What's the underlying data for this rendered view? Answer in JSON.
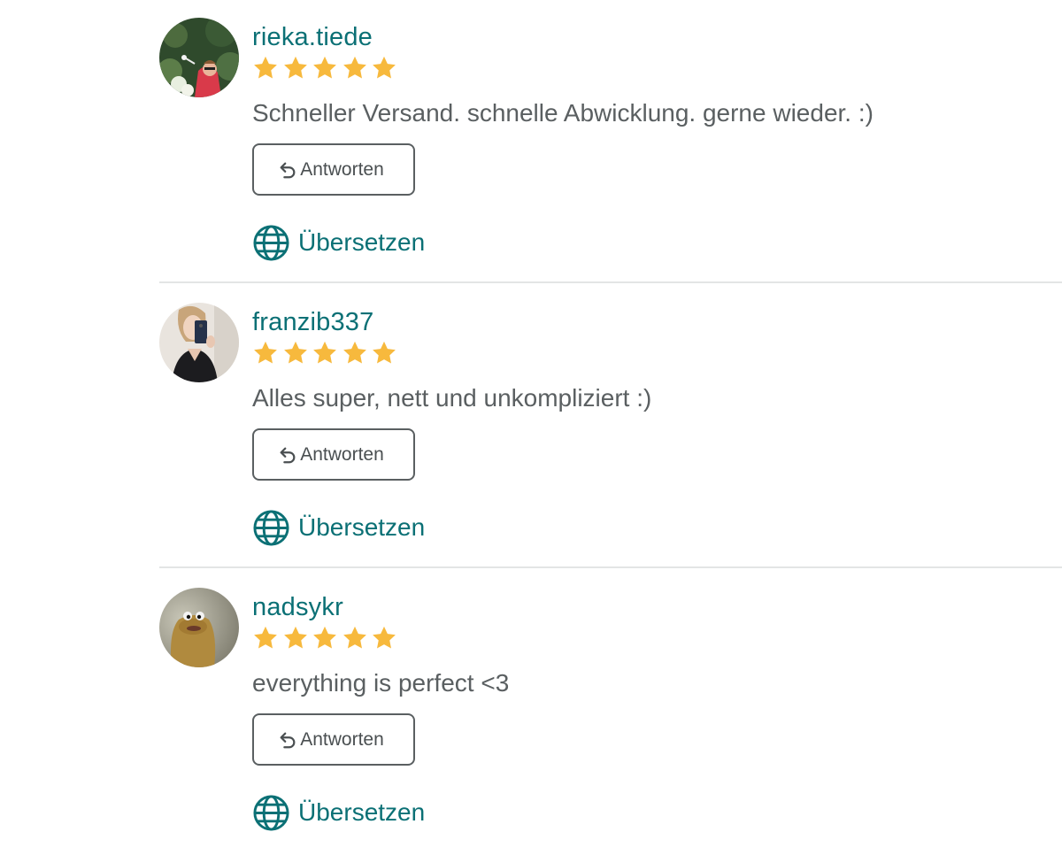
{
  "colors": {
    "accent": "#0b7075",
    "text": "#5a5f61",
    "star": "#f7b93d",
    "divider": "#e3e5e5"
  },
  "reviews": [
    {
      "username": "rieka.tiede",
      "rating": 5,
      "comment": "Schneller Versand. schnelle Abwicklung. gerne wieder. :)",
      "reply_label": "Antworten",
      "translate_label": "Übersetzen",
      "avatar_icon": "user-photo-avatar"
    },
    {
      "username": "franzib337",
      "rating": 5,
      "comment": "Alles super, nett und unkompliziert :)",
      "reply_label": "Antworten",
      "translate_label": "Übersetzen",
      "avatar_icon": "user-photo-avatar"
    },
    {
      "username": "nadsykr",
      "rating": 5,
      "comment": "everything is perfect <3",
      "reply_label": "Antworten",
      "translate_label": "Übersetzen",
      "avatar_icon": "user-photo-avatar"
    }
  ],
  "icons": {
    "reply": "reply-arrow-icon",
    "translate": "globe-icon",
    "rating": "star-icon"
  }
}
